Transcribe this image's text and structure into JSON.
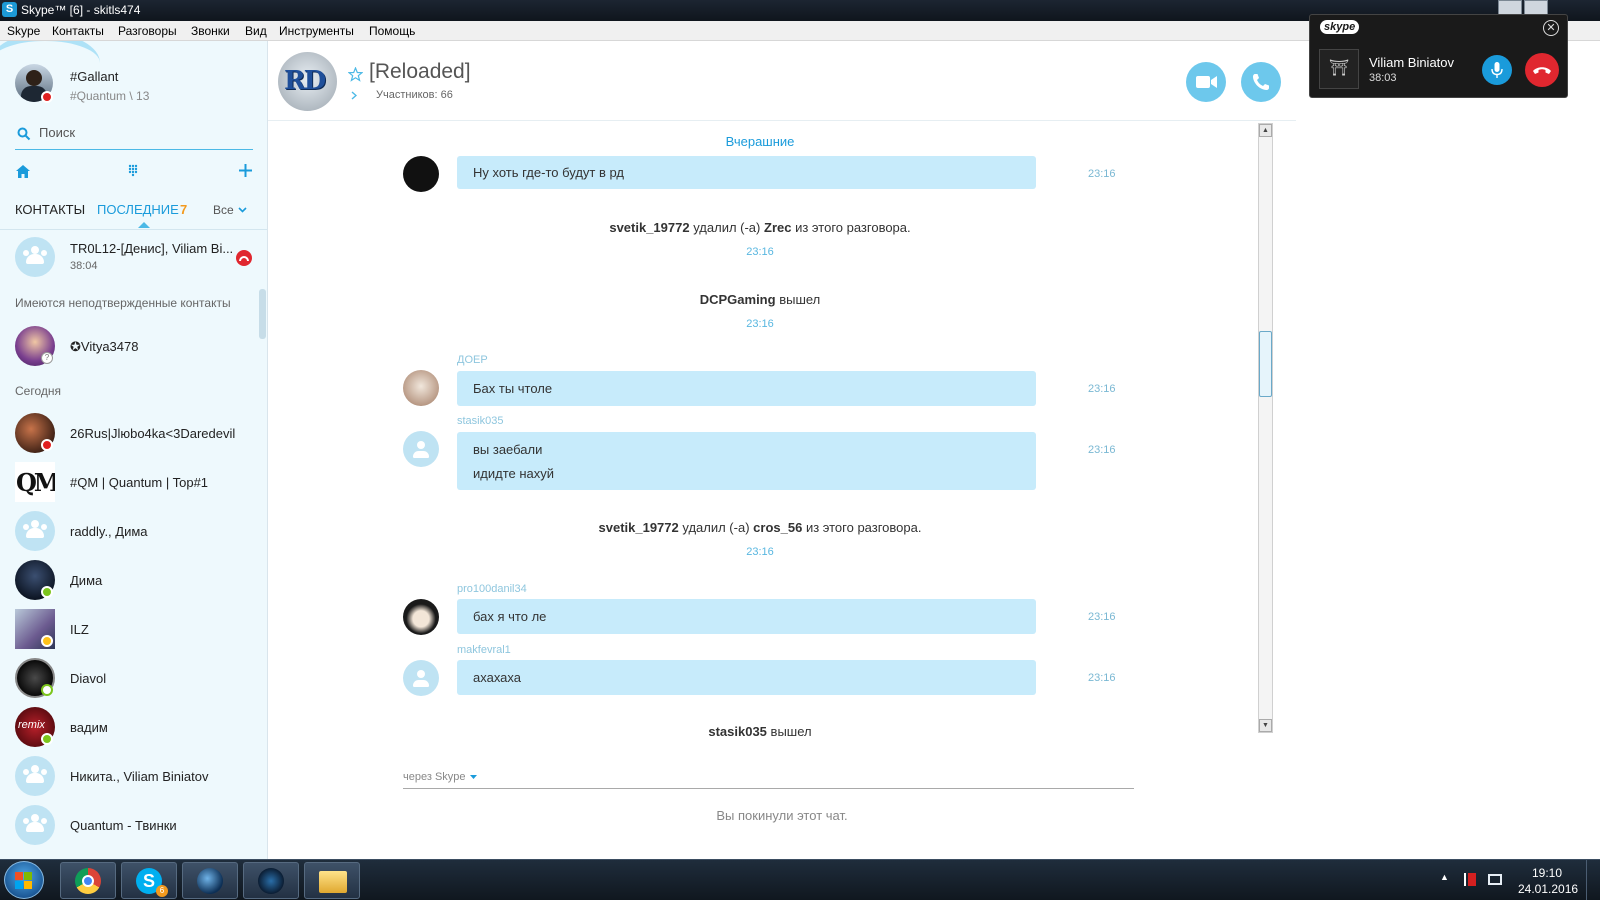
{
  "window": {
    "title": "Skype™ [6] - skitls474"
  },
  "menu": [
    "Skype",
    "Контакты",
    "Разговоры",
    "Звонки",
    "Вид",
    "Инструменты",
    "Помощь"
  ],
  "profile": {
    "name": "#Gallant",
    "mood": "#Quantum \\ 13"
  },
  "search": {
    "placeholder": "Поиск"
  },
  "tabs": {
    "contacts": "КОНТАКТЫ",
    "recent": "ПОСЛЕДНИЕ",
    "recent_count": "7",
    "filter": "Все"
  },
  "active_call_item": {
    "name": "TR0L12-[Денис], Viliam Bi...",
    "time": "38:04"
  },
  "sections": {
    "pending": "Имеются неподтвержденные контакты",
    "today": "Сегодня"
  },
  "pending_contacts": [
    {
      "name": "✪Vitya3478"
    }
  ],
  "recent_contacts": [
    {
      "name": "26Rus|Jlюbo4ka<3Daredevil",
      "status": "busy"
    },
    {
      "name": "#QM | Quantum | Top#1",
      "status": "none"
    },
    {
      "name": "raddly., Дима",
      "status": "group"
    },
    {
      "name": "Дима",
      "status": "online"
    },
    {
      "name": "ILZ",
      "status": "away"
    },
    {
      "name": "Diavol",
      "status": "offline"
    },
    {
      "name": "вадим",
      "status": "online"
    },
    {
      "name": "Никита., Viliam Biniatov",
      "status": "group"
    },
    {
      "name": "Quantum - Твинки",
      "status": "group"
    }
  ],
  "conversation": {
    "avatar_text": "RD",
    "title": "[Reloaded]",
    "participants": "Участников: 66",
    "date_divider": "Вчерашние",
    "messages": [
      {
        "type": "msg",
        "sender": "",
        "lines": [
          "Ну хоть где-то будут в рд"
        ],
        "time": "23:16"
      },
      {
        "type": "sys",
        "actor": "svetik_19772",
        "action": "удалил (-а)",
        "target": "Zrec",
        "suffix": "из этого разговора.",
        "time": "23:16"
      },
      {
        "type": "sys",
        "actor": "DCPGaming",
        "action": "вышел",
        "target": "",
        "suffix": "",
        "time": "23:16"
      },
      {
        "type": "msg",
        "sender": "ДОЕР",
        "lines": [
          "Бах ты чтоле"
        ],
        "time": "23:16"
      },
      {
        "type": "msg",
        "sender": "stasik035",
        "lines": [
          "вы заебали",
          "идидте нахуй"
        ],
        "time": "23:16"
      },
      {
        "type": "sys",
        "actor": "svetik_19772",
        "action": "удалил (-а)",
        "target": "cros_56",
        "suffix": "из этого разговора.",
        "time": "23:16"
      },
      {
        "type": "msg",
        "sender": "pro100danil34",
        "lines": [
          "бах я что ле"
        ],
        "time": "23:16"
      },
      {
        "type": "msg",
        "sender": "makfevral1",
        "lines": [
          "ахахаха"
        ],
        "time": "23:16"
      },
      {
        "type": "sys",
        "actor": "stasik035",
        "action": "вышел",
        "target": "",
        "suffix": "",
        "time": ""
      }
    ],
    "via": "через Skype",
    "left_notice": "Вы покинули этот чат."
  },
  "call_popup": {
    "brand": "skype",
    "name": "Viliam Biniatov",
    "duration": "38:03"
  },
  "taskbar": {
    "clock_time": "19:10",
    "clock_date": "24.01.2016",
    "skype_badge": "6"
  },
  "colors": {
    "accent": "#00aff0",
    "bubble": "#c7ebfb",
    "busy": "#e02020",
    "online": "#7cc51c"
  }
}
